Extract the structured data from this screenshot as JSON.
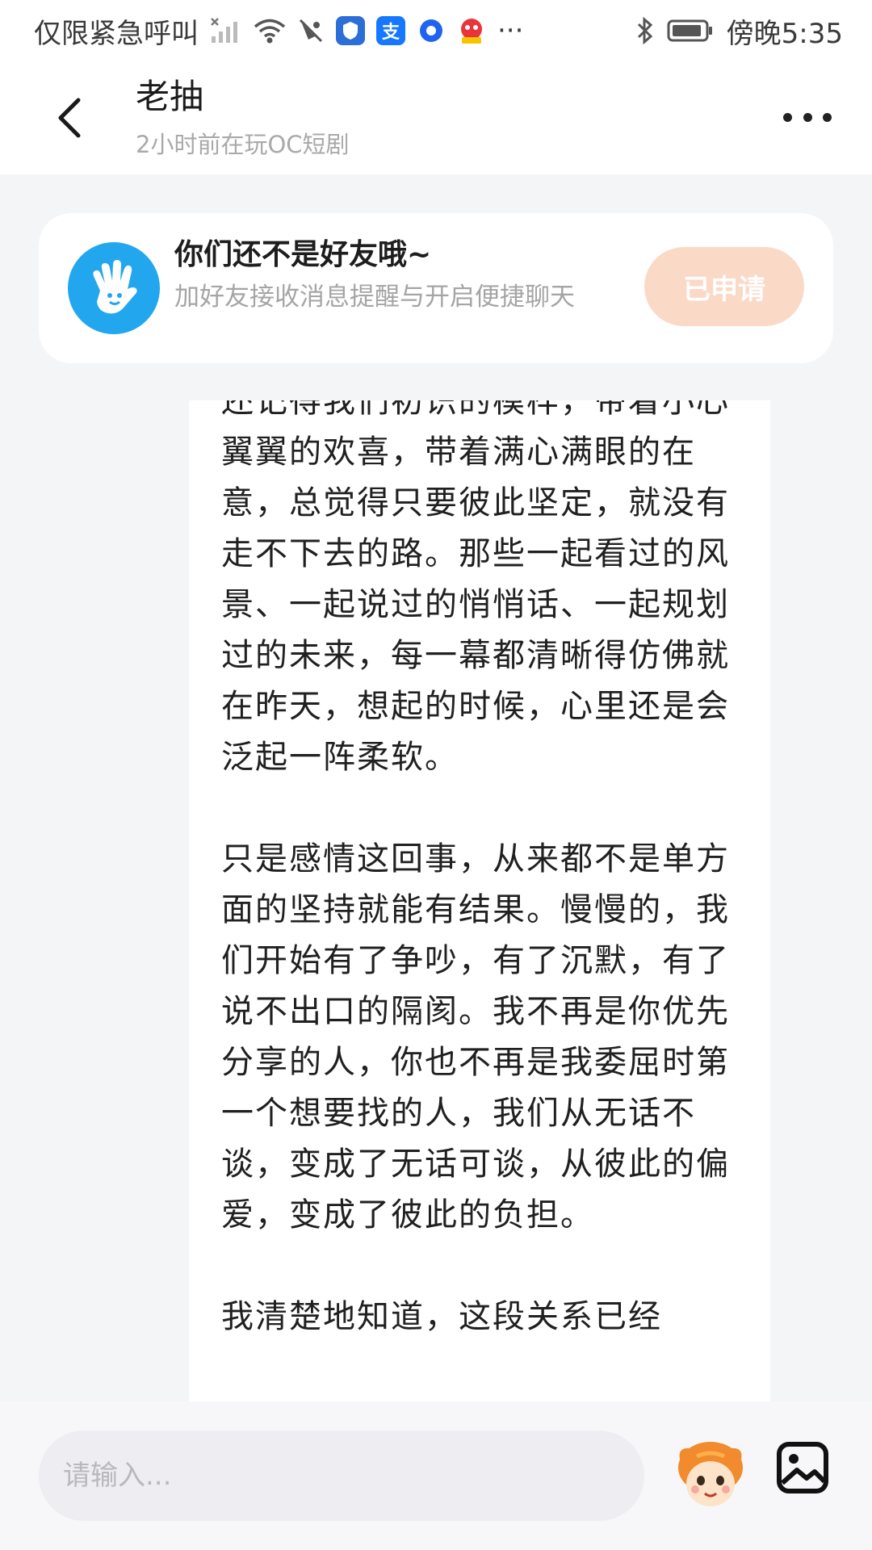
{
  "status_bar": {
    "carrier_text": "仅限紧急呼叫",
    "overflow_dots": "···",
    "time": "傍晚5:35",
    "app_icons": [
      "shield-app-icon",
      "alipay-icon",
      "browser-icon",
      "game-app-icon"
    ],
    "alipay_char": "支"
  },
  "header": {
    "title": "老抽",
    "subtitle": "2小时前在玩OC短剧"
  },
  "friend_banner": {
    "title": "你们还不是好友哦~",
    "description": "加好友接收消息提醒与开启便捷聊天",
    "button_label": "已申请",
    "button_color": "#fbd9c7",
    "avatar_color": "#22a7ee"
  },
  "message": {
    "paragraphs": [
      "还记得我们初识的模样，带着小心翼翼的欢喜，带着满心满眼的在意，总觉得只要彼此坚定，就没有走不下去的路。那些一起看过的风景、一起说过的悄悄话、一起规划过的未来，每一幕都清晰得仿佛就在昨天，想起的时候，心里还是会泛起一阵柔软。",
      "只是感情这回事，从来都不是单方面的坚持就能有结果。慢慢的，我们开始有了争吵，有了沉默，有了说不出口的隔阂。我不再是你优先分享的人，你也不再是我委屈时第一个想要找的人，我们从无话不谈，变成了无话可谈，从彼此的偏爱，变成了彼此的负担。",
      "我清楚地知道，这段关系已经"
    ]
  },
  "input": {
    "placeholder": "请输入..."
  }
}
